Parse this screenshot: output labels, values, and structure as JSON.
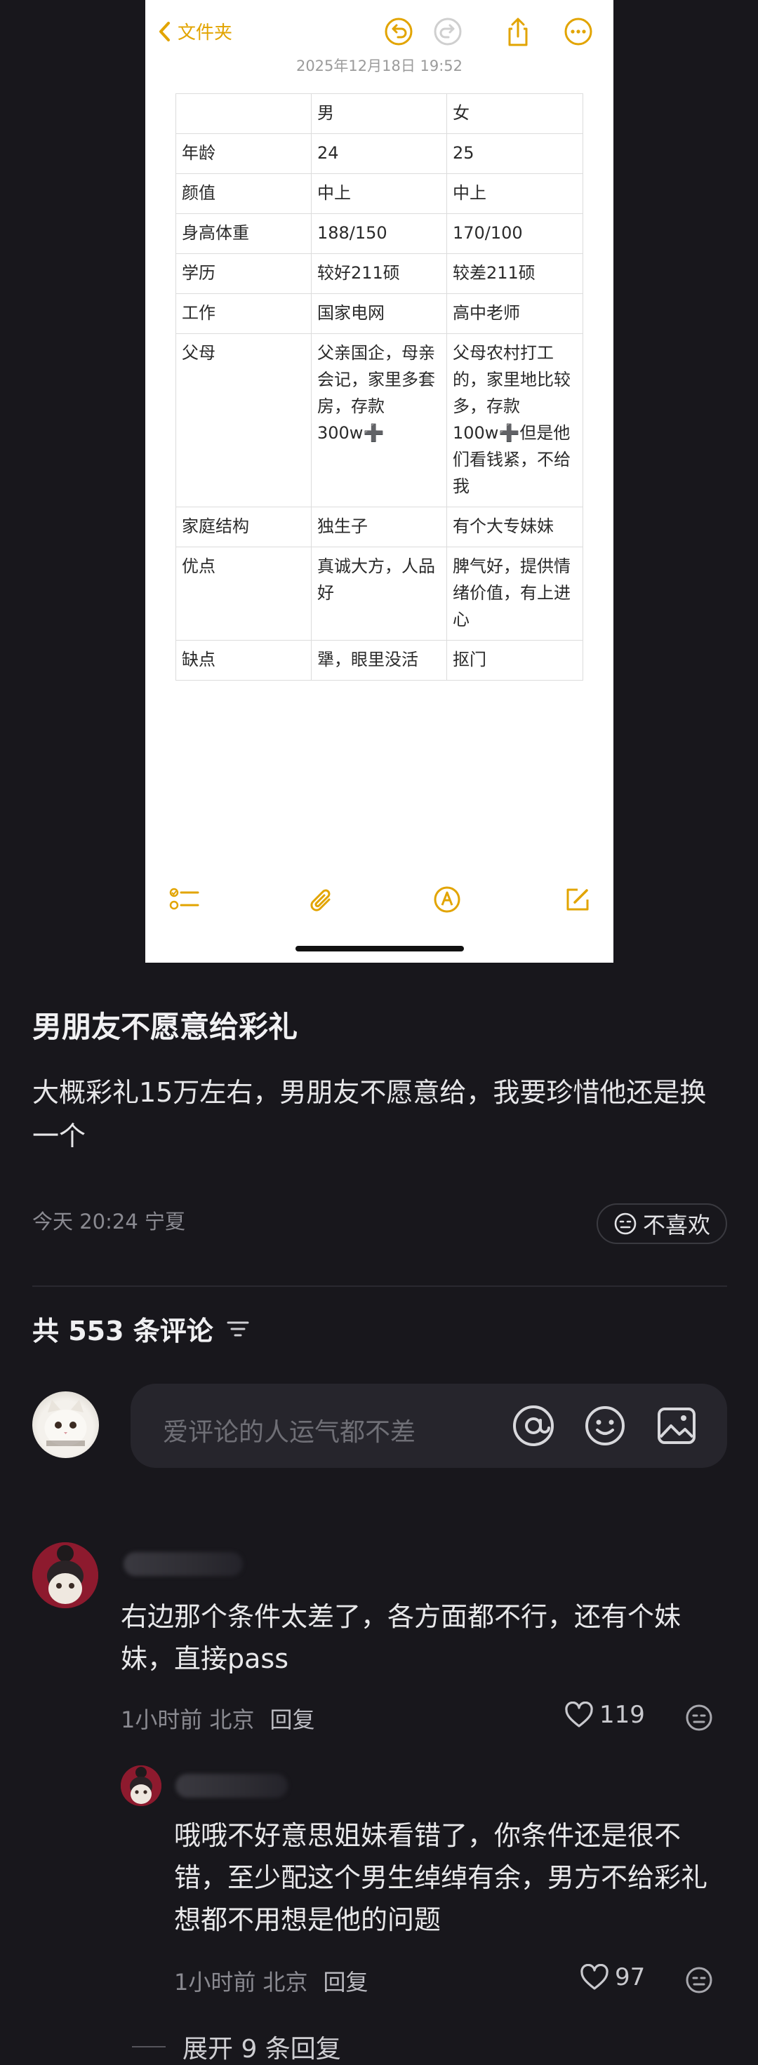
{
  "screenshot": {
    "back_label": "文件夹",
    "date": "2025年12月18日 19:52",
    "table": {
      "header": [
        "",
        "男",
        "女"
      ],
      "rows": [
        [
          "年龄",
          "24",
          "25"
        ],
        [
          "颜值",
          "中上",
          "中上"
        ],
        [
          "身高体重",
          "188/150",
          "170/100"
        ],
        [
          "学历",
          "较好211硕",
          "较差211硕"
        ],
        [
          "工作",
          "国家电网",
          "高中老师"
        ],
        [
          "父母",
          "父亲国企，母亲会记，家里多套房，存款300w➕",
          "父母农村打工的，家里地比较多，存款100w➕但是他们看钱紧，不给我"
        ],
        [
          "家庭结构",
          "独生子",
          "有个大专妹妹"
        ],
        [
          "优点",
          "真诚大方，人品好",
          "脾气好，提供情绪价值，有上进心"
        ],
        [
          "缺点",
          "犟，眼里没活",
          "抠门"
        ]
      ]
    },
    "accent_color": "#e2a400"
  },
  "post": {
    "title": "男朋友不愿意给彩礼",
    "body": "大概彩礼15万左右，男朋友不愿意给，我要珍惜他还是换一个",
    "meta": "今天 20:24 宁夏",
    "dislike_label": "不喜欢"
  },
  "comments_header": {
    "count_label": "共 553 条评论"
  },
  "comment_input": {
    "placeholder": "爱评论的人运气都不差"
  },
  "comments": [
    {
      "text": "右边那个条件太差了，各方面都不行，还有个妹妹，直接pass",
      "time_location": "1小时前 北京",
      "reply_label": "回复",
      "likes": "119"
    },
    {
      "text": "哦哦不好意思姐妹看错了，你条件还是很不错，至少配这个男生绰绰有余，男方不给彩礼想都不用想是他的问题",
      "time_location": "1小时前 北京",
      "reply_label": "回复",
      "likes": "97"
    }
  ],
  "expand_label": "展开 9 条回复"
}
